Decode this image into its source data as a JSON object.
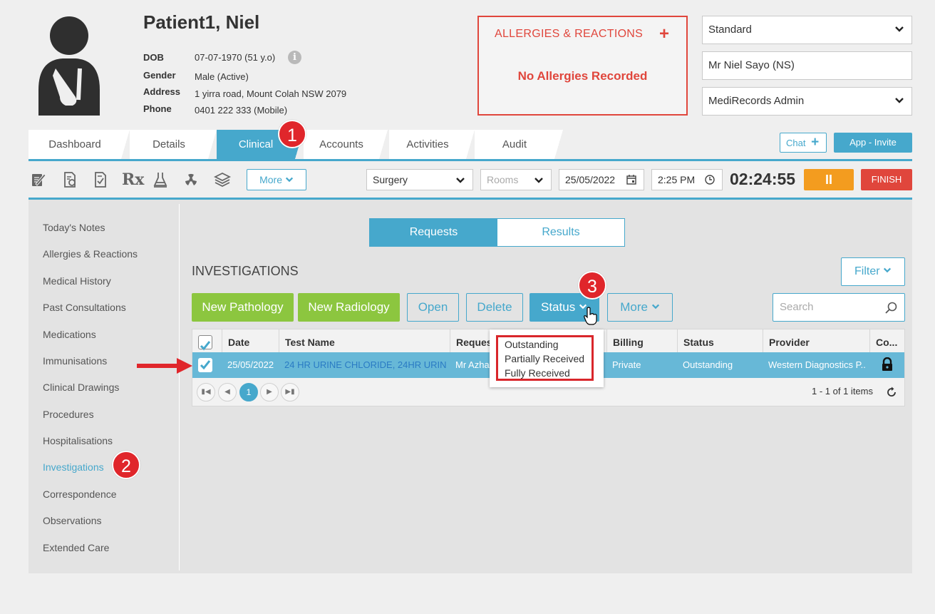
{
  "patient": {
    "name": "Patient1, Niel",
    "details": [
      {
        "label": "DOB",
        "value": "07-07-1970 (51 y.o)"
      },
      {
        "label": "Gender",
        "value": "Male (Active)"
      },
      {
        "label": "Address",
        "value": "1 yirra road, Mount Colah NSW 2079"
      },
      {
        "label": "Phone",
        "value": "0401 222 333 (Mobile)"
      }
    ],
    "info_icon": "i"
  },
  "allergies": {
    "title": "ALLERGIES & REACTIONS",
    "add_icon": "+",
    "message": "No Allergies Recorded"
  },
  "header_selects": {
    "template": "Standard",
    "practitioner": "Mr Niel Sayo (NS)",
    "user": "MediRecords Admin"
  },
  "tabs": [
    {
      "label": "Dashboard"
    },
    {
      "label": "Details"
    },
    {
      "label": "Clinical"
    },
    {
      "label": "Accounts"
    },
    {
      "label": "Activities"
    },
    {
      "label": "Audit"
    }
  ],
  "chat": {
    "label": "Chat",
    "icon": "+"
  },
  "app_invite": {
    "label": "App - Invite"
  },
  "toolbar": {
    "icons": [
      "notes-icon",
      "document-icon",
      "report-icon",
      "prescription-icon",
      "lab-flask-icon",
      "radiation-icon",
      "stack-icon"
    ],
    "rx_label": "Rx",
    "more_label": "More",
    "location": "Surgery",
    "rooms_placeholder": "Rooms",
    "date": "25/05/2022",
    "time": "2:25 PM",
    "timer": "02:24:55",
    "pause_label": "II",
    "finish_label": "FINISH"
  },
  "sidebar": {
    "items": [
      {
        "label": "Today's Notes"
      },
      {
        "label": "Allergies & Reactions"
      },
      {
        "label": "Medical History"
      },
      {
        "label": "Past Consultations"
      },
      {
        "label": "Medications"
      },
      {
        "label": "Immunisations"
      },
      {
        "label": "Clinical Drawings"
      },
      {
        "label": "Procedures"
      },
      {
        "label": "Hospitalisations"
      },
      {
        "label": "Investigations"
      },
      {
        "label": "Correspondence"
      },
      {
        "label": "Observations"
      },
      {
        "label": "Extended Care"
      }
    ],
    "active": "Investigations"
  },
  "main": {
    "segments": {
      "requests": "Requests",
      "results": "Results",
      "active": "Requests"
    },
    "title": "INVESTIGATIONS",
    "filter_label": "Filter",
    "actions": {
      "new_pathology": "New Pathology",
      "new_radiology": "New Radiology",
      "open": "Open",
      "delete": "Delete",
      "status": "Status",
      "more": "More"
    },
    "search_placeholder": "Search",
    "table": {
      "columns": [
        "Date",
        "Test Name",
        "Request",
        "Billing",
        "Status",
        "Provider",
        "Co..."
      ],
      "rows": [
        {
          "checked": true,
          "date": "25/05/2022",
          "test_name": "24 HR URINE CHLORIDE, 24HR URINE ...",
          "requester": "Mr Azhar",
          "billing": "Private",
          "status": "Outstanding",
          "provider": "Western Diagnostics P...",
          "confidential": "lock-icon"
        }
      ]
    },
    "pager": {
      "current_page": "1",
      "info": "1 - 1 of 1 items"
    }
  },
  "status_dropdown": {
    "options": [
      "Outstanding",
      "Partially Received",
      "Fully Received"
    ]
  },
  "callouts": [
    "1",
    "2",
    "3"
  ],
  "colors": {
    "accent": "#46a8cc",
    "danger": "#e0463c",
    "green": "#8cc63f",
    "pause": "#f39c1f",
    "selected_row": "#67b8d7"
  }
}
